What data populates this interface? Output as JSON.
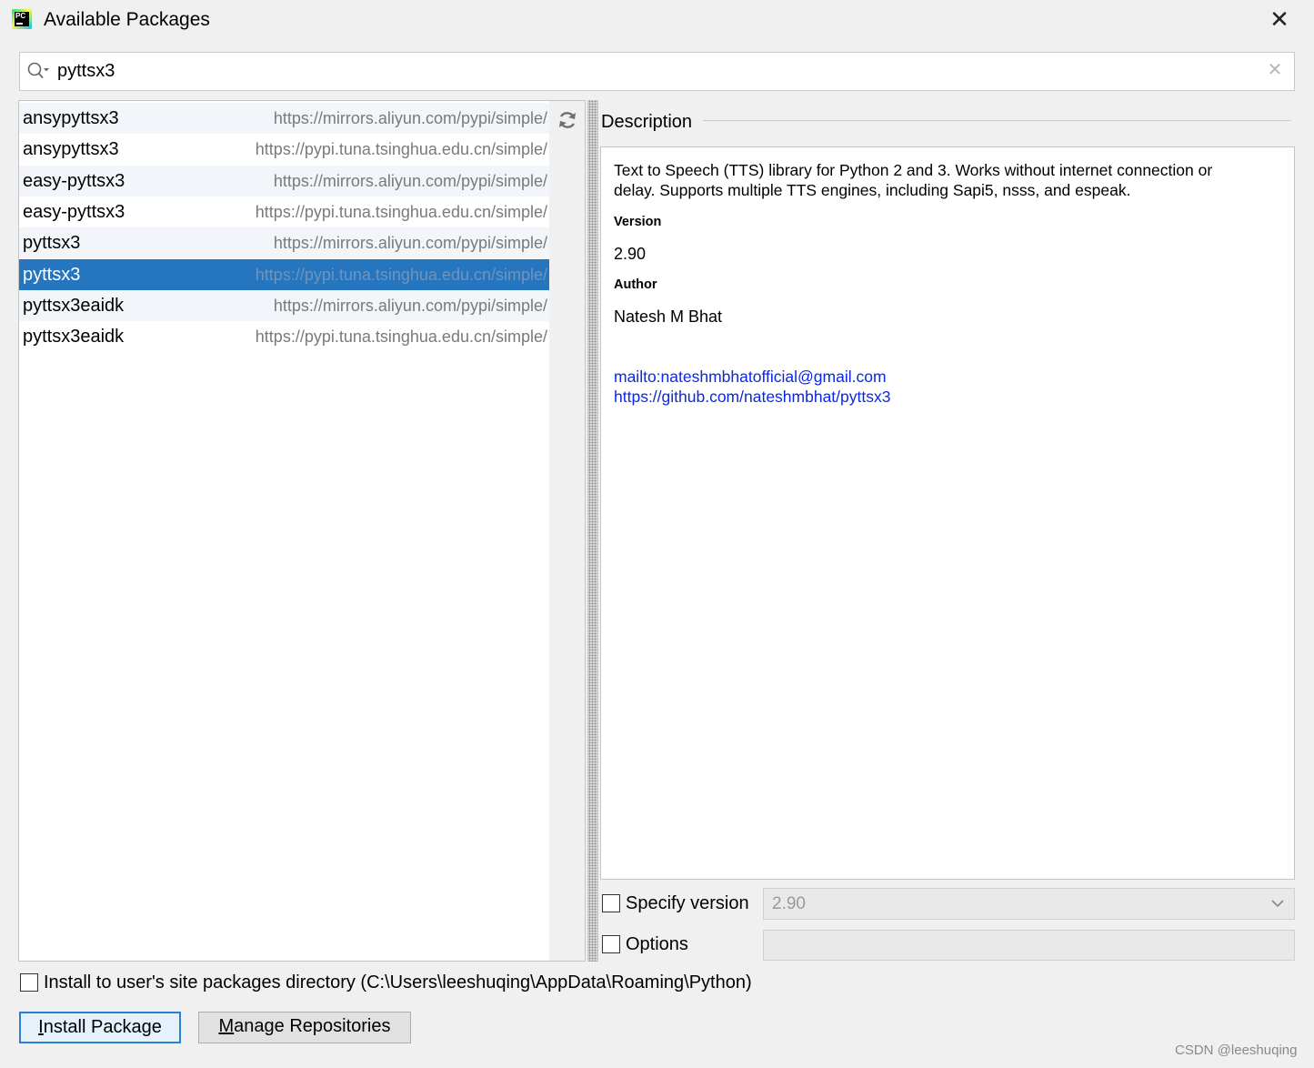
{
  "window": {
    "icon_text": "PC",
    "title": "Available Packages",
    "close_glyph": "✕"
  },
  "search": {
    "value": "pyttsx3",
    "icon": "search-icon",
    "clear_glyph": "✕"
  },
  "packages": [
    {
      "name": "ansypyttsx3",
      "repo": "https://mirrors.aliyun.com/pypi/simple/",
      "selected": false
    },
    {
      "name": "ansypyttsx3",
      "repo": "https://pypi.tuna.tsinghua.edu.cn/simple/",
      "selected": false
    },
    {
      "name": "easy-pyttsx3",
      "repo": "https://mirrors.aliyun.com/pypi/simple/",
      "selected": false
    },
    {
      "name": "easy-pyttsx3",
      "repo": "https://pypi.tuna.tsinghua.edu.cn/simple/",
      "selected": false
    },
    {
      "name": "pyttsx3",
      "repo": "https://mirrors.aliyun.com/pypi/simple/",
      "selected": false
    },
    {
      "name": "pyttsx3",
      "repo": "https://pypi.tuna.tsinghua.edu.cn/simple/",
      "selected": true
    },
    {
      "name": "pyttsx3eaidk",
      "repo": "https://mirrors.aliyun.com/pypi/simple/",
      "selected": false
    },
    {
      "name": "pyttsx3eaidk",
      "repo": "https://pypi.tuna.tsinghua.edu.cn/simple/",
      "selected": false
    }
  ],
  "description": {
    "title": "Description",
    "summary_line1": "Text to Speech (TTS) library for Python 2 and 3. Works without internet connection or",
    "summary_line2": "delay. Supports multiple TTS engines, including Sapi5, nsss, and espeak.",
    "version_label": "Version",
    "version": "2.90",
    "author_label": "Author",
    "author": "Natesh M Bhat",
    "links": [
      "mailto:nateshmbhatofficial@gmail.com",
      "https://github.com/nateshmbhat/pyttsx3"
    ]
  },
  "options": {
    "specify_version_label": "Specify version",
    "specify_version_checked": false,
    "version_value": "2.90",
    "options_label": "Options",
    "options_checked": false,
    "options_value": ""
  },
  "install_user_label": "Install to user's site packages directory (C:\\Users\\leeshuqing\\AppData\\Roaming\\Python)",
  "install_user_checked": false,
  "buttons": {
    "install_mnemonic": "I",
    "install_rest": "nstall Package",
    "manage_mnemonic": "M",
    "manage_rest": "anage Repositories"
  },
  "watermark": "CSDN @leeshuqing",
  "colors": {
    "selection": "#2675bf",
    "link": "#0a28e6",
    "alt_row": "#f2f5f9",
    "background": "#f0f0f0"
  }
}
